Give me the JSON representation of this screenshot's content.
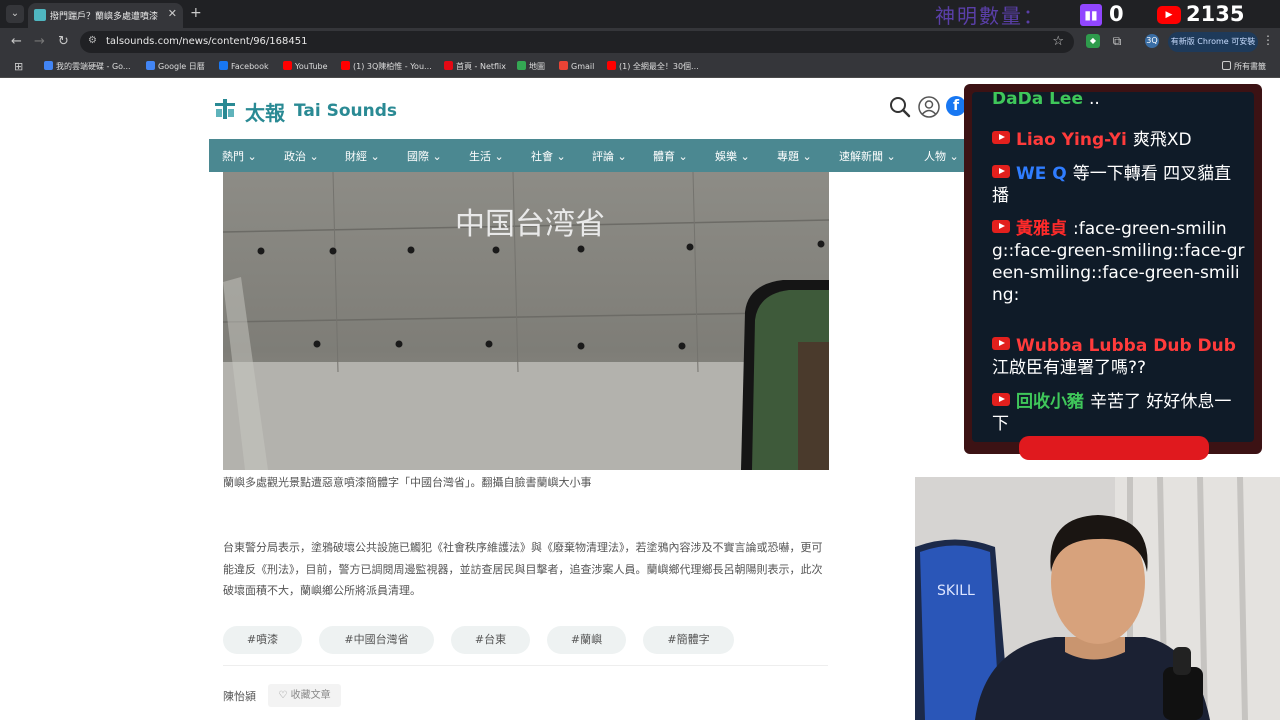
{
  "browser": {
    "tab_title": "撥門踹戶？蘭嶼多處遭噴漆「中...",
    "url": "talsounds.com/news/content/96/168451",
    "update_label": "有新版 Chrome 可安裝",
    "bookmarks": [
      {
        "label": "我的雲端硬碟 - Go...",
        "color": "#4285f4"
      },
      {
        "label": "Google 日曆",
        "color": "#4285f4"
      },
      {
        "label": "Facebook",
        "color": "#1877f2"
      },
      {
        "label": "YouTube",
        "color": "#ff0000"
      },
      {
        "label": "(1) 3Q陳柏惟 - You...",
        "color": "#ff0000"
      },
      {
        "label": "首頁 - Netflix",
        "color": "#e50914"
      },
      {
        "label": "地圖",
        "color": "#34a853"
      },
      {
        "label": "Gmail",
        "color": "#ea4335"
      },
      {
        "label": "(1) 全網最全！30個...",
        "color": "#ff0000"
      }
    ],
    "all_bookmarks": "所有書籤"
  },
  "overlay": {
    "viewer_label": "神明數量：",
    "twitch_count": "0",
    "youtube_count": "2135"
  },
  "site": {
    "logo_zh": "太報",
    "logo_en": "Tai Sounds",
    "nav": [
      "熱門",
      "政治",
      "財經",
      "國際",
      "生活",
      "社會",
      "評論",
      "體育",
      "娛樂",
      "專題",
      "速解新聞",
      "人物"
    ]
  },
  "article": {
    "photo_text": "中国台湾省",
    "caption": "蘭嶼多處觀光景點遭惡意噴漆簡體字「中國台灣省」。翻攝自臉書蘭嶼大小事",
    "body": "台東警分局表示，塗鴉破壞公共設施已觸犯《社會秩序維護法》與《廢棄物清理法》，若塗鴉內容涉及不實言論或恐嚇，更可能違反《刑法》，目前，警方已調閱周邊監視器，並訪查居民與目擊者，追查涉案人員。蘭嶼鄉代理鄉長呂朝陽則表示，此次破壞面積不大，蘭嶼鄉公所將派員清理。",
    "tags": [
      "#噴漆",
      "#中國台灣省",
      "#台東",
      "#蘭嶼",
      "#簡體字"
    ],
    "author": "陳怡潁",
    "save_label": "收藏文章"
  },
  "chat": {
    "messages": [
      {
        "author": "DaDa Lee",
        "text": "..",
        "color": "#3fc75a"
      },
      {
        "author": "Liao Ying-Yi",
        "text": "爽飛XD",
        "color": "#ff3b3b"
      },
      {
        "author": "WE Q",
        "text": "等一下轉看 四叉貓直播",
        "color": "#2f7dff"
      },
      {
        "author": "黃雅貞",
        "text": ":face-green-smiling::face-green-smiling::face-green-smiling::face-green-smiling:",
        "color": "#ff2a2a"
      },
      {
        "author": "Wubba Lubba Dub Dub",
        "text": "江啟臣有連署了嗎??",
        "color": "#ff3b3b"
      },
      {
        "author": "回收小豬",
        "text": "辛苦了 好好休息一下",
        "color": "#3fc75a"
      }
    ]
  },
  "webcam": {
    "chair_logo": "SKILL"
  }
}
